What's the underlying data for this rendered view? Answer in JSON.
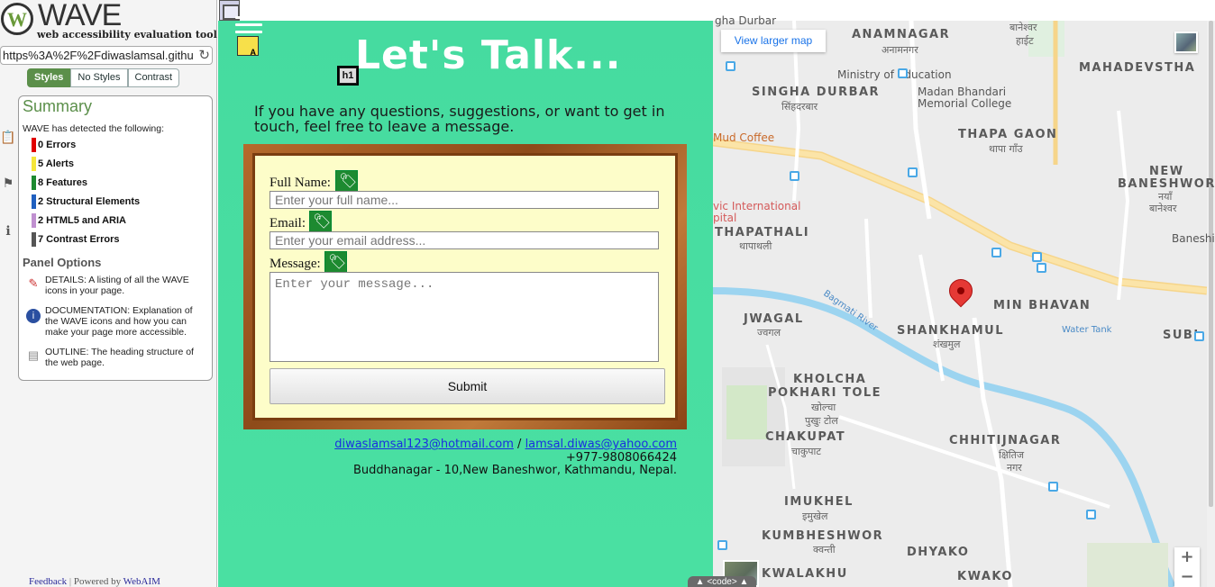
{
  "wave": {
    "logo_letter": "W",
    "logo_text": "WAVE",
    "tagline": "web accessibility evaluation tool",
    "url": "https%3A%2F%2Fdiwaslamsal.githu",
    "tabs": [
      "Styles",
      "No Styles",
      "Contrast"
    ],
    "summary_title": "Summary",
    "detected_text": "WAVE has detected the following:",
    "categories": [
      {
        "label": "0 Errors",
        "color": "#e00000"
      },
      {
        "label": "5 Alerts",
        "color": "#f5e63a"
      },
      {
        "label": "8 Features",
        "color": "#1d8a30"
      },
      {
        "label": "2 Structural Elements",
        "color": "#1f5fbf"
      },
      {
        "label": "2 HTML5 and ARIA",
        "color": "#c090d0"
      },
      {
        "label": "7 Contrast Errors",
        "color": "#555555"
      }
    ],
    "panel_options_title": "Panel Options",
    "options": [
      {
        "icon": "details-flag-icon",
        "text": "DETAILS: A listing of all the WAVE icons in your page."
      },
      {
        "icon": "info-icon",
        "text": "DOCUMENTATION: Explanation of the WAVE icons and how you can make your page more accessible."
      },
      {
        "icon": "outline-doc-icon",
        "text": "OUTLINE: The heading structure of the web page."
      }
    ],
    "footer_feedback": "Feedback",
    "footer_sep": "|",
    "footer_powered": "Powered by",
    "footer_webaim": "WebAIM"
  },
  "page": {
    "heading": "Let's Talk...",
    "h1_badge": "h1",
    "alt_badge": "A",
    "intro": "If you have any questions, suggestions, or want to get in touch, feel free to leave a message.",
    "form": {
      "name_label": "Full Name:",
      "name_placeholder": "Enter your full name...",
      "email_label": "Email:",
      "email_placeholder": "Enter your email address...",
      "message_label": "Message:",
      "message_placeholder": "Enter your message...",
      "submit_label": "Submit"
    },
    "contact": {
      "email1": "diwaslamsal123@hotmail.com",
      "sep": " / ",
      "email2": "lamsal.diwas@yahoo.com",
      "phone": "+977-9808066424",
      "address": "Buddhanagar - 10,New Baneshwor, Kathmandu, Nepal."
    },
    "code_tab": "▲ <code> ▲"
  },
  "map": {
    "larger_map": "View larger map",
    "labels": [
      {
        "t": "ANAMNAGAR"
      },
      {
        "t": "अनामनगर"
      },
      {
        "t": "SINGHA DURBAR"
      },
      {
        "t": "सिंहदरबार"
      },
      {
        "t": "MAHADEVSTHA"
      },
      {
        "t": "THAPA GAON"
      },
      {
        "t": "थापा गाँउ"
      },
      {
        "t": "NEW"
      },
      {
        "t": "BANESHWOR"
      },
      {
        "t": "नयाँ"
      },
      {
        "t": "बानेश्वर"
      },
      {
        "t": "THAPATHALI"
      },
      {
        "t": "थापाथली"
      },
      {
        "t": "MIN BHAVAN"
      },
      {
        "t": "JWAGAL"
      },
      {
        "t": "ज्वगल"
      },
      {
        "t": "SHANKHAMUL"
      },
      {
        "t": "शंखमुल"
      },
      {
        "t": "SUBI"
      },
      {
        "t": "KHOLCHA"
      },
      {
        "t": "POKHARI TOLE"
      },
      {
        "t": "खोल्चा"
      },
      {
        "t": "पुखुः टोल"
      },
      {
        "t": "CHAKUPAT"
      },
      {
        "t": "चाकुपाट"
      },
      {
        "t": "CHHITIJNAGAR"
      },
      {
        "t": "क्षितिज"
      },
      {
        "t": "नगर"
      },
      {
        "t": "IMUKHEL"
      },
      {
        "t": "इमुखेल"
      },
      {
        "t": "KUMBHESHWOR"
      },
      {
        "t": "क्वन्ती"
      },
      {
        "t": "DHYAKO"
      },
      {
        "t": "KWAKO"
      },
      {
        "t": "KWALAKHU"
      }
    ],
    "small": [
      {
        "t": "Ministry of Education"
      },
      {
        "t": "Madan Bhandari"
      },
      {
        "t": "Memorial College"
      },
      {
        "t": "Mud Coffee"
      },
      {
        "t": "vic International"
      },
      {
        "t": "pital"
      },
      {
        "t": "Water Tank"
      },
      {
        "t": "Bagmati River"
      },
      {
        "t": "Baneshi"
      },
      {
        "t": "gha Durbar"
      },
      {
        "t": "बानेश्वर"
      },
      {
        "t": "हाईट"
      }
    ],
    "zoom_in": "+",
    "zoom_out": "−"
  }
}
